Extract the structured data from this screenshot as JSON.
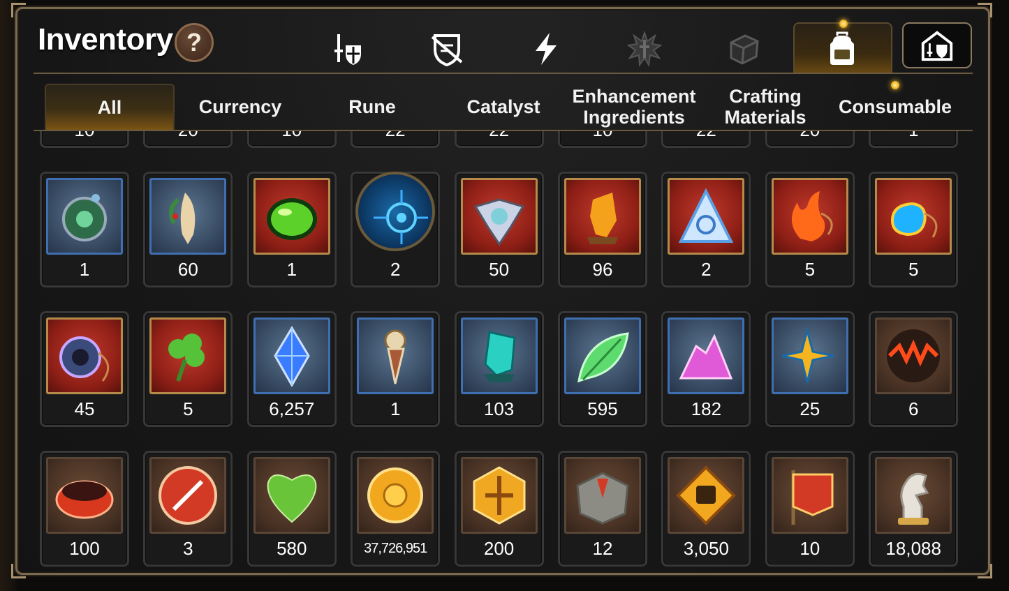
{
  "title": "Inventory",
  "help_label": "?",
  "category_icons": [
    "sword-shield-icon",
    "broken-shield-icon",
    "lightning-icon",
    "splash-cross-icon",
    "dice-icon",
    "backpack-icon"
  ],
  "tabs": [
    {
      "label": "All"
    },
    {
      "label": "Currency"
    },
    {
      "label": "Rune"
    },
    {
      "label": "Catalyst"
    },
    {
      "label": "Enhancement\nIngredients"
    },
    {
      "label": "Crafting\nMaterials"
    },
    {
      "label": "Consumable"
    }
  ],
  "partial_row_counts": [
    "10",
    "20",
    "10",
    "22",
    "22",
    "10",
    "22",
    "20",
    "1"
  ],
  "rows": [
    [
      {
        "icon": "green-compass-icon",
        "frame": "blue",
        "count": "1"
      },
      {
        "icon": "ginseng-root-icon",
        "frame": "blue",
        "count": "60"
      },
      {
        "icon": "green-orb-icon",
        "frame": "red",
        "count": "1"
      },
      {
        "icon": "blue-rune-disc-icon",
        "frame": "round",
        "count": "2"
      },
      {
        "icon": "eye-crest-icon",
        "frame": "red",
        "count": "50"
      },
      {
        "icon": "amber-crystal-icon",
        "frame": "red",
        "count": "96"
      },
      {
        "icon": "triquetra-crystal-icon",
        "frame": "red",
        "count": "2"
      },
      {
        "icon": "flame-amulet-icon",
        "frame": "red",
        "count": "5"
      },
      {
        "icon": "water-amulet-icon",
        "frame": "red",
        "count": "5"
      }
    ],
    [
      {
        "icon": "ring-amulet-icon",
        "frame": "red",
        "count": "45"
      },
      {
        "icon": "clover-amulet-icon",
        "frame": "red",
        "count": "5"
      },
      {
        "icon": "blue-gem-icon",
        "frame": "blue",
        "count": "6,257"
      },
      {
        "icon": "clock-pendant-icon",
        "frame": "blue",
        "count": "1"
      },
      {
        "icon": "teal-crystal-icon",
        "frame": "blue",
        "count": "103"
      },
      {
        "icon": "green-leaf-icon",
        "frame": "blue",
        "count": "595"
      },
      {
        "icon": "pink-crystal-pile-icon",
        "frame": "blue",
        "count": "182"
      },
      {
        "icon": "star-compass-amulet-icon",
        "frame": "blue",
        "count": "25"
      },
      {
        "icon": "lava-orb-icon",
        "frame": "brown",
        "count": "6"
      }
    ],
    [
      {
        "icon": "red-bracelet-icon",
        "frame": "brown",
        "count": "100"
      },
      {
        "icon": "red-badge-icon",
        "frame": "brown",
        "count": "3"
      },
      {
        "icon": "green-heart-icon",
        "frame": "brown",
        "count": "580"
      },
      {
        "icon": "gold-coin-icon",
        "frame": "brown",
        "count": "37,726,951"
      },
      {
        "icon": "gold-hex-emblem-icon",
        "frame": "brown",
        "count": "200"
      },
      {
        "icon": "stone-compass-icon",
        "frame": "brown",
        "count": "12"
      },
      {
        "icon": "fist-badge-icon",
        "frame": "brown",
        "count": "3,050"
      },
      {
        "icon": "red-banner-icon",
        "frame": "brown",
        "count": "10"
      },
      {
        "icon": "knight-chess-icon",
        "frame": "brown",
        "count": "18,088"
      }
    ]
  ],
  "colors": {
    "accent_gold": "#f0b020",
    "frame_blue": "#3f6fb0",
    "frame_red": "#b58a4a",
    "panel_border": "#7b6a4f"
  }
}
